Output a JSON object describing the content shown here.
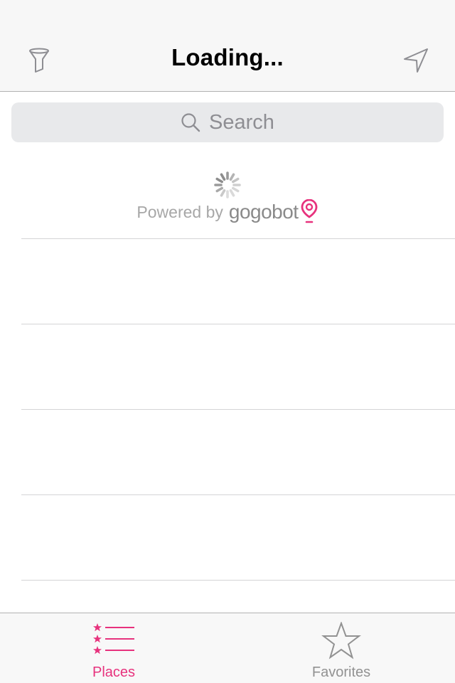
{
  "nav": {
    "title": "Loading...",
    "left_icon": "filter-icon",
    "right_icon": "location-arrow-icon"
  },
  "search": {
    "placeholder": "Search",
    "icon": "search-icon"
  },
  "loading": {
    "spinner_icon": "activity-spinner-icon",
    "powered_by": "Powered by",
    "brand": "gogobot",
    "brand_icon": "map-pin-icon"
  },
  "list": {
    "row_count": 5
  },
  "tabs": [
    {
      "label": "Places",
      "icon": "starred-list-icon",
      "selected": true
    },
    {
      "label": "Favorites",
      "icon": "star-icon",
      "selected": false
    }
  ],
  "colors": {
    "accent": "#e7327d",
    "tab_inactive": "#929292",
    "bar_background": "#f7f7f7",
    "search_background": "#e8e9eb"
  }
}
